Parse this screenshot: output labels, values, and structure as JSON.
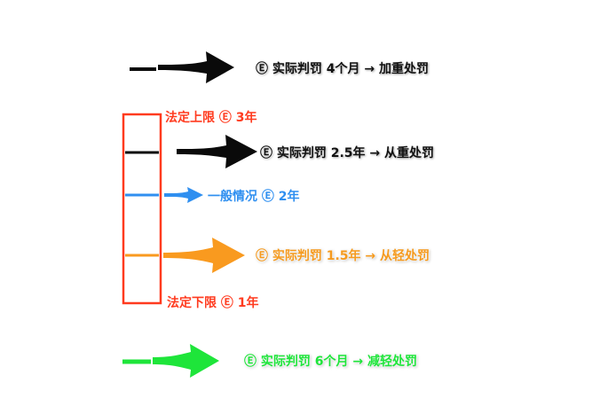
{
  "colors": {
    "black": "#0a0a0a",
    "range_box": "#ff3b1f",
    "legal_label": "#ff3b1f",
    "general": "#2f8ff0",
    "orange": "#f99a1f",
    "orange_label": "#f59a1e",
    "green": "#1ee53a",
    "green_label": "#1ee53a"
  },
  "icons": {
    "symbol": "circled-e-icon"
  },
  "labels": {
    "top_case": "Ⓔ 实际判罚 4个月 → 加重处罚",
    "upper_limit": "法定上限 Ⓔ 3年",
    "heavier_case": "Ⓔ 实际判罚 2.5年 → 从重处罚",
    "general_case": "一般情况 Ⓔ 2年",
    "lighter_case": "Ⓔ 实际判罚 1.5年 → 从轻处罚",
    "lower_limit": "法定下限 Ⓔ 1年",
    "reduced_case": "Ⓔ 实际判罚 6个月 → 减轻处罚"
  }
}
